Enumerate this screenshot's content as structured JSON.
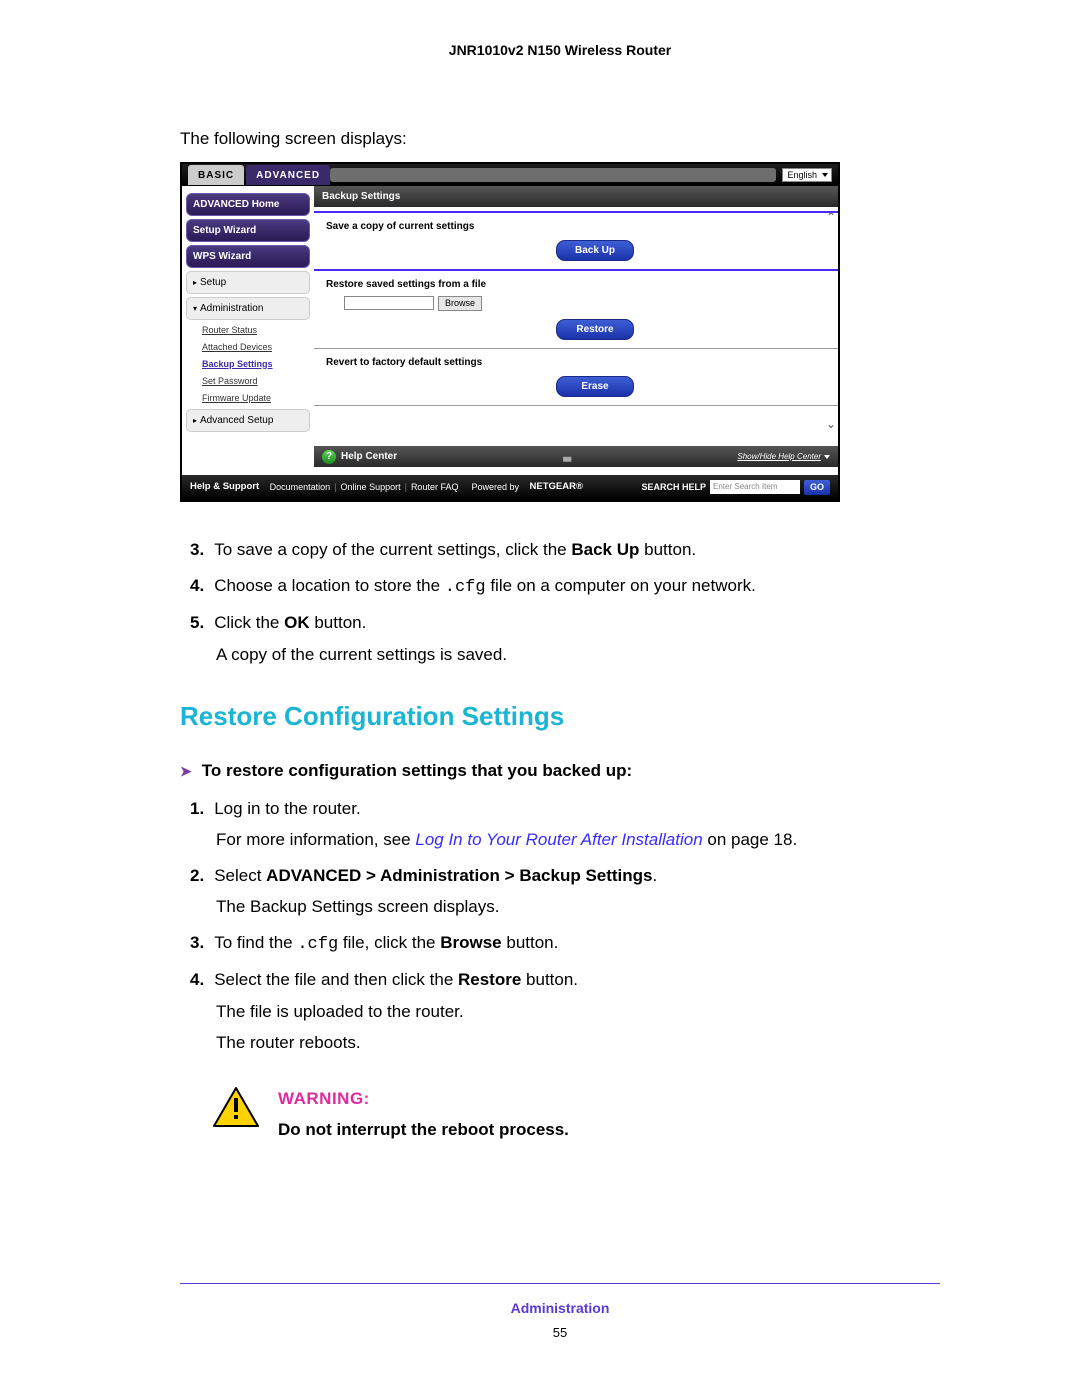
{
  "doc": {
    "header": "JNR1010v2 N150 Wireless Router",
    "intro": "The following screen displays:",
    "footerSection": "Administration",
    "pageNumber": "55"
  },
  "router": {
    "tabs": {
      "basic": "BASIC",
      "advanced": "ADVANCED"
    },
    "language": "English",
    "sidebar": {
      "home": "ADVANCED Home",
      "setupWizard": "Setup Wizard",
      "wpsWizard": "WPS Wizard",
      "setup": "Setup",
      "administration": "Administration",
      "subitems": {
        "routerStatus": "Router Status",
        "attachedDevices": "Attached Devices",
        "backupSettings": "Backup Settings",
        "setPassword": "Set Password",
        "firmwareUpdate": "Firmware Update"
      },
      "advancedSetup": "Advanced Setup"
    },
    "content": {
      "title": "Backup Settings",
      "saveLabel": "Save a copy of current settings",
      "backupBtn": "Back Up",
      "restoreLabel": "Restore saved settings from a file",
      "browseBtn": "Browse",
      "restoreBtn": "Restore",
      "revertLabel": "Revert to factory default settings",
      "eraseBtn": "Erase"
    },
    "helpCenter": {
      "label": "Help Center",
      "showHide": "Show/Hide Help Center"
    },
    "footer": {
      "helpSupport": "Help & Support",
      "documentation": "Documentation",
      "onlineSupport": "Online Support",
      "routerFaq": "Router FAQ",
      "poweredBy": "Powered by",
      "brand": "NETGEAR",
      "searchLabel": "SEARCH HELP",
      "searchPlaceholder": "Enter Search Item",
      "go": "GO"
    }
  },
  "stepsTop": {
    "s3": {
      "num": "3.",
      "textA": "To save a copy of the current settings, click the ",
      "bold": "Back Up",
      "textB": " button."
    },
    "s4": {
      "num": "4.",
      "textA": "Choose a location to store the ",
      "code": ".cfg",
      "textB": " file on a computer on your network."
    },
    "s5": {
      "num": "5.",
      "textA": "Click the ",
      "bold": "OK",
      "textB": " button.",
      "follow": "A copy of the current settings is saved."
    }
  },
  "restore": {
    "heading": "Restore Configuration Settings",
    "procTitle": "To restore configuration settings that you backed up:",
    "s1": {
      "num": "1.",
      "text": "Log in to the router.",
      "followA": "For more information, see ",
      "link": "Log In to Your Router After Installation",
      "followB": " on page 18."
    },
    "s2": {
      "num": "2.",
      "textA": "Select ",
      "bold": "ADVANCED > Administration > Backup Settings",
      "textB": ".",
      "follow": "The Backup Settings screen displays."
    },
    "s3": {
      "num": "3.",
      "textA": "To find the ",
      "code": ".cfg",
      "textB": " file, click the ",
      "bold": "Browse",
      "textC": " button."
    },
    "s4": {
      "num": "4.",
      "textA": "Select the file and then click the ",
      "bold": "Restore",
      "textB": " button.",
      "follow1": "The file is uploaded to the router.",
      "follow2": "The router reboots."
    }
  },
  "warning": {
    "label": "WARNING:",
    "message": "Do not interrupt the reboot process."
  }
}
